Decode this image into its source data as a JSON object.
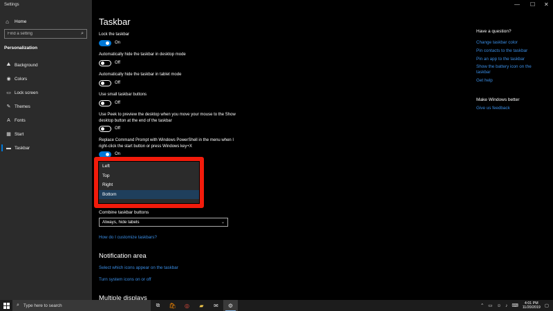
{
  "window": {
    "title": "Settings",
    "minimize": "—",
    "maximize": "☐",
    "close": "✕"
  },
  "sidebar": {
    "home": "Home",
    "search_placeholder": "Find a setting",
    "section": "Personalization",
    "items": [
      {
        "label": "Background",
        "icon": "⛰"
      },
      {
        "label": "Colors",
        "icon": "◉"
      },
      {
        "label": "Lock screen",
        "icon": "▭"
      },
      {
        "label": "Themes",
        "icon": "✎"
      },
      {
        "label": "Fonts",
        "icon": "A"
      },
      {
        "label": "Start",
        "icon": "▦"
      },
      {
        "label": "Taskbar",
        "icon": "▬"
      }
    ]
  },
  "main": {
    "title": "Taskbar",
    "settings": [
      {
        "label": "Lock the taskbar",
        "state": "On"
      },
      {
        "label": "Automatically hide the taskbar in desktop mode",
        "state": "Off"
      },
      {
        "label": "Automatically hide the taskbar in tablet mode",
        "state": "Off"
      },
      {
        "label": "Use small taskbar buttons",
        "state": "Off"
      },
      {
        "label": "Use Peek to preview the desktop when you move your mouse to the Show desktop button at the end of the taskbar",
        "state": "Off"
      },
      {
        "label": "Replace Command Prompt with Windows PowerShell in the menu when I right-click the start button or press Windows key+X",
        "state": "On"
      }
    ],
    "location_options": [
      "Left",
      "Top",
      "Right",
      "Bottom"
    ],
    "location_selected": "Bottom",
    "combine_label": "Combine taskbar buttons",
    "combine_value": "Always, hide labels",
    "customize_link": "How do I customize taskbars?",
    "notification_heading": "Notification area",
    "notification_links": [
      "Select which icons appear on the taskbar",
      "Turn system icons on or off"
    ],
    "multiple_displays_heading": "Multiple displays"
  },
  "right_panel": {
    "question_heading": "Have a question?",
    "question_links": [
      "Change taskbar color",
      "Pin contacts to the taskbar",
      "Pin an app to the taskbar",
      "Show the battery icon on the taskbar",
      "Get help"
    ],
    "better_heading": "Make Windows better",
    "better_links": [
      "Give us feedback"
    ]
  },
  "taskbar": {
    "search_text": "Type here to search",
    "apps": [
      {
        "name": "task-view",
        "icon": "⧉"
      },
      {
        "name": "store",
        "icon": "🛍"
      },
      {
        "name": "chrome",
        "icon": "◎"
      },
      {
        "name": "file-explorer",
        "icon": "▰"
      },
      {
        "name": "mail",
        "icon": "✉"
      },
      {
        "name": "settings",
        "icon": "⚙"
      }
    ],
    "time": "4:01 PM",
    "date": "11/20/2019"
  },
  "colors": {
    "accent": "#0078d7",
    "highlight_border": "#f21b0b",
    "link": "#3a8ee6",
    "sidebar": "#2b2b2b"
  }
}
